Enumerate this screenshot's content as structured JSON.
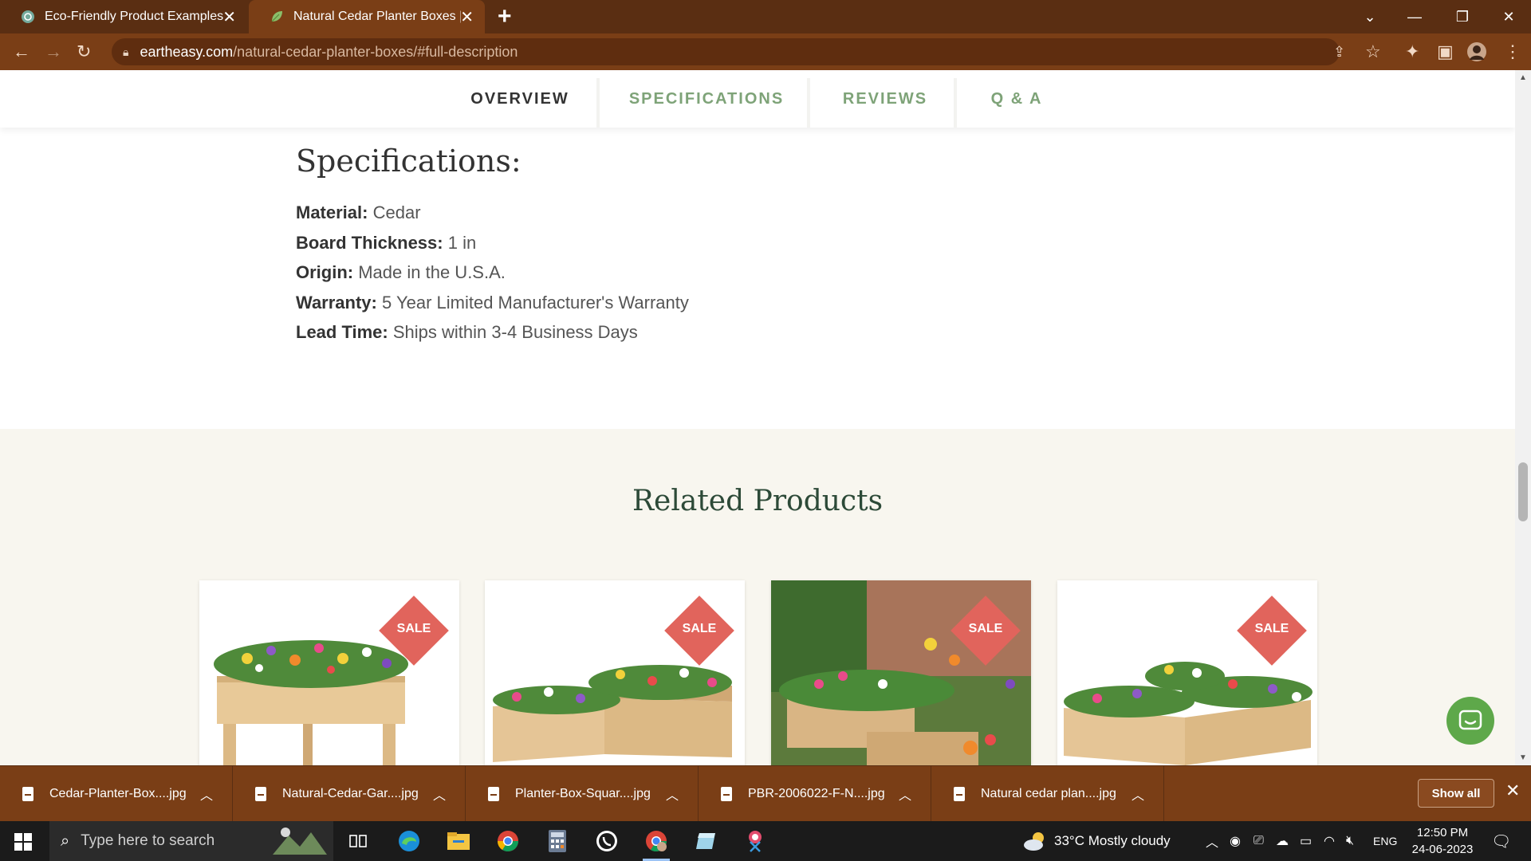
{
  "browser": {
    "tabs": [
      {
        "title": "Eco-Friendly Product Examples",
        "active": false
      },
      {
        "title": "Natural Cedar Planter Boxes | Ear",
        "active": true
      }
    ],
    "url_host": "eartheasy.com",
    "url_path": "/natural-cedar-planter-boxes/#full-description"
  },
  "subnav": {
    "items": [
      "OVERVIEW",
      "SPECIFICATIONS",
      "REVIEWS",
      "Q & A"
    ],
    "active": "OVERVIEW"
  },
  "specifications": {
    "title": "Specifications:",
    "rows": [
      {
        "key": "Material:",
        "value": "Cedar"
      },
      {
        "key": "Board Thickness:",
        "value": "1 in"
      },
      {
        "key": "Origin:",
        "value": "Made in the U.S.A."
      },
      {
        "key": "Warranty:",
        "value": "5 Year Limited Manufacturer's Warranty"
      },
      {
        "key": "Lead Time:",
        "value": "Ships within 3-4 Business Days"
      }
    ]
  },
  "related": {
    "title": "Related Products",
    "products": [
      {
        "badge": "SALE"
      },
      {
        "badge": "SALE"
      },
      {
        "badge": "SALE"
      },
      {
        "badge": "SALE"
      }
    ]
  },
  "downloads": {
    "items": [
      "Cedar-Planter-Box....jpg",
      "Natural-Cedar-Gar....jpg",
      "Planter-Box-Squar....jpg",
      "PBR-2006022-F-N....jpg",
      "Natural cedar plan....jpg"
    ],
    "show_all": "Show all"
  },
  "taskbar": {
    "search_placeholder": "Type here to search",
    "weather": "33°C  Mostly cloudy",
    "language": "ENG",
    "time": "12:50 PM",
    "date": "24-06-2023"
  },
  "colors": {
    "chrome_dark": "#5a2e12",
    "chrome": "#7a3e16",
    "accent_green": "#7ea378",
    "sale_red": "#e1645c",
    "heading_green": "#2d4a38"
  }
}
